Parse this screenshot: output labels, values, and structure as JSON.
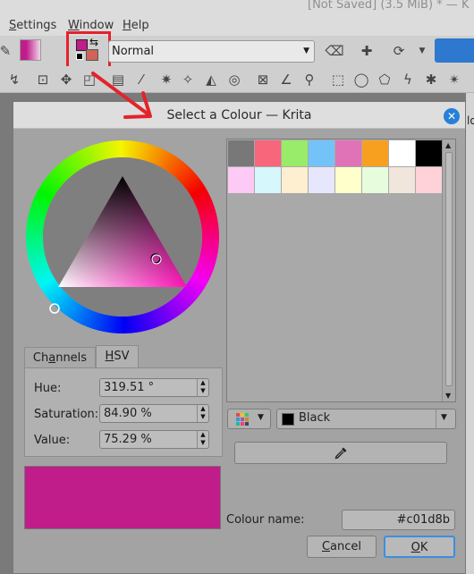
{
  "window": {
    "title_fragment": "[Not Saved]  (3.5 MiB) * — K"
  },
  "menubar": {
    "items": [
      {
        "label": "Settings"
      },
      {
        "label": "Window"
      },
      {
        "label": "Help"
      }
    ]
  },
  "toolbar": {
    "blend_mode": "Normal",
    "foreground_color": "#c01d8b",
    "background_color": "#d0645a",
    "highlight_color": "#e3232b"
  },
  "dialog": {
    "title": "Select a Colour — Krita",
    "tabs": [
      {
        "label": "Channels",
        "active": false
      },
      {
        "label": "HSV",
        "active": true
      }
    ],
    "hsv": {
      "hue_label": "Hue:",
      "hue_value": "319.51 °",
      "saturation_label": "Saturation:",
      "saturation_value": "84.90 %",
      "value_label": "Value:",
      "value_value": "75.29 %"
    },
    "preview_color": "#c01d8b",
    "palette": {
      "swatches": [
        "#787878",
        "#f7667a",
        "#99ec6a",
        "#74c3f8",
        "#e073b7",
        "#f7a01f",
        "#ffffff",
        "#000000",
        "#fccaf4",
        "#d6f7fb",
        "#fdefcf",
        "#e6e7fd",
        "#ffffcc",
        "#e7fcdc",
        "#f0e6dc",
        "#ffd1d8"
      ],
      "selected_color_name": "Black",
      "selected_color": "#000000"
    },
    "colour_name_label": "Colour name:",
    "colour_name_value": "#c01d8b",
    "cancel_label": "Cancel",
    "ok_label": "OK"
  }
}
